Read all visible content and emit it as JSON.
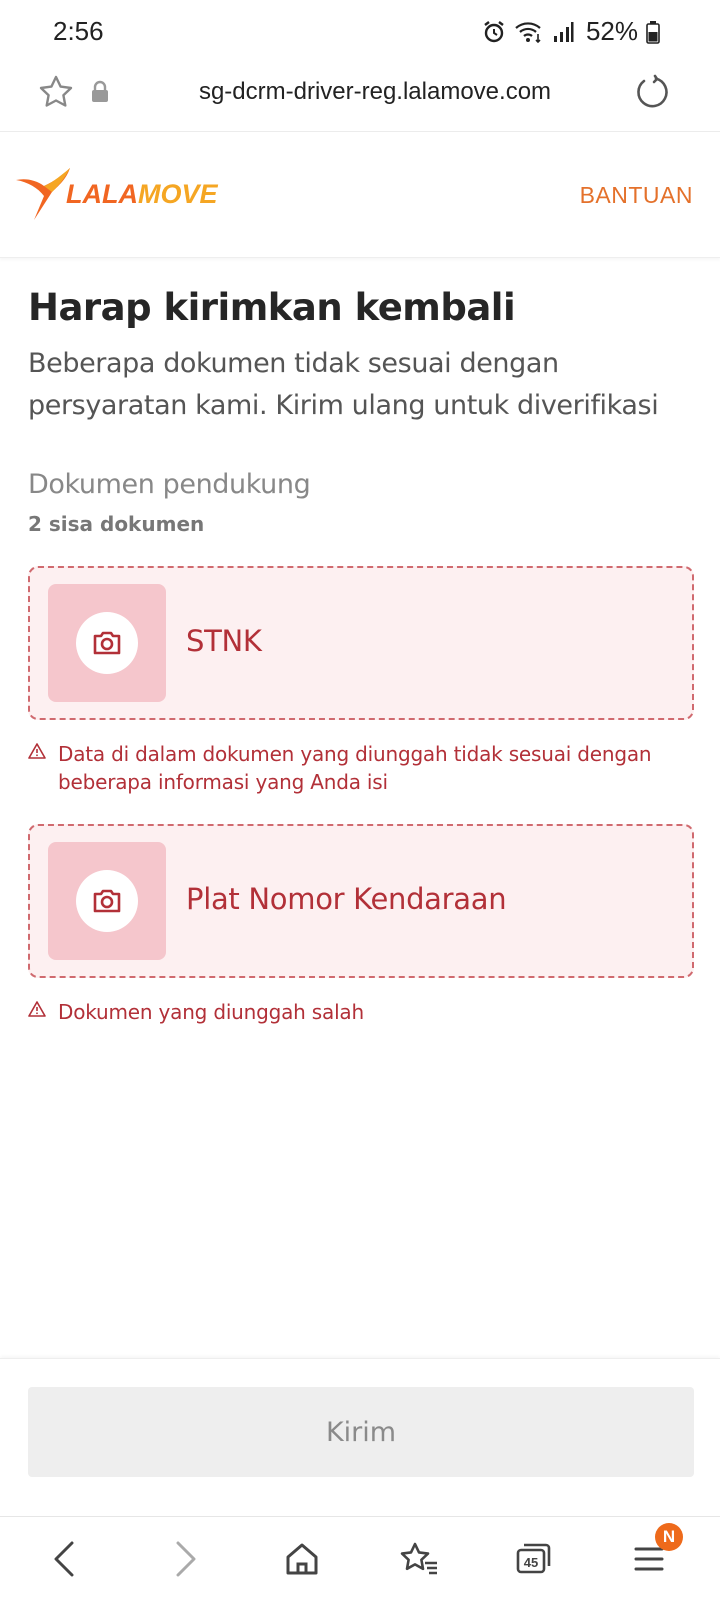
{
  "status_bar": {
    "time": "2:56",
    "battery": "52%",
    "icons": [
      "alarm-icon",
      "wifi-icon",
      "signal-icon",
      "battery-icon"
    ]
  },
  "browser": {
    "url": "sg-dcrm-driver-reg.lalamove.com",
    "icons": [
      "star-icon",
      "lock-icon",
      "reload-icon"
    ]
  },
  "header": {
    "logo_part1": "LALA",
    "logo_part2": "MOVE",
    "help_label": "BANTUAN"
  },
  "main": {
    "title": "Harap kirimkan kembali",
    "subtitle": "Beberapa dokumen tidak sesuai dengan persyaratan kami. Kirim ulang untuk diverifikasi",
    "section_title": "Dokumen pendukung",
    "section_count": "2 sisa dokumen",
    "documents": [
      {
        "label": "STNK",
        "error": "Data di dalam dokumen yang diunggah tidak sesuai dengan beberapa informasi yang Anda isi"
      },
      {
        "label": "Plat Nomor Kendaraan",
        "error": "Dokumen yang diunggah salah"
      }
    ]
  },
  "action": {
    "submit_label": "Kirim"
  },
  "navbar": {
    "tabs_count": "45",
    "menu_badge": "N"
  },
  "colors": {
    "brand_orange": "#f16622",
    "brand_yellow": "#f5a623",
    "error_red": "#b23038",
    "card_bg": "#fdf0f1",
    "thumb_bg": "#f5c6cc"
  }
}
